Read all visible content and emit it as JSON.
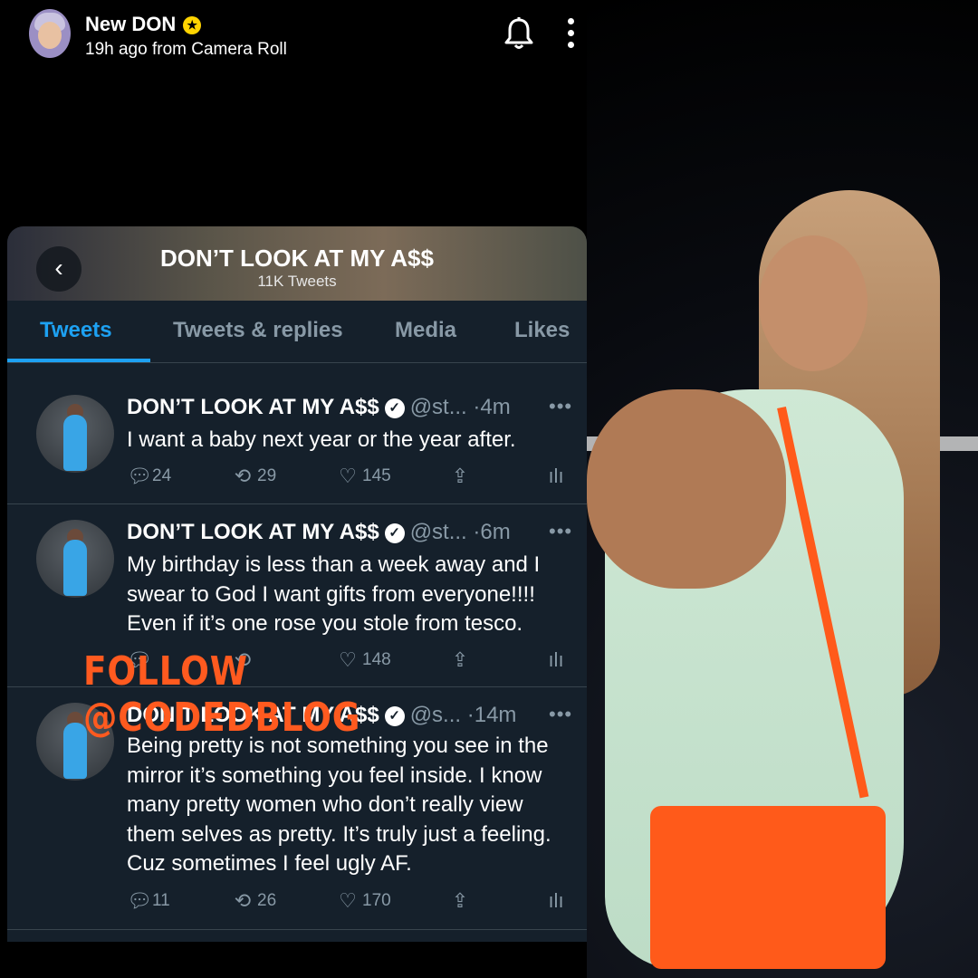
{
  "snap_header": {
    "name": "New DON",
    "subtitle": "19h ago from Camera Roll"
  },
  "twitter": {
    "profile_name": "DON’T LOOK AT MY A$$",
    "tweet_count": "11K Tweets",
    "tabs": [
      "Tweets",
      "Tweets & replies",
      "Media",
      "Likes"
    ],
    "tweets": [
      {
        "name": "DON’T LOOK AT MY A$$",
        "handle": "@st...",
        "time": "·4m",
        "text": "I want a baby next year or the year after.",
        "replies": "24",
        "retweets": "29",
        "likes": "145"
      },
      {
        "name": "DON’T LOOK AT MY A$$",
        "handle": "@st...",
        "time": "·6m",
        "text": "My birthday is less than a week away and I swear to God I want gifts from everyone!!!! Even if it’s one rose you stole from tesco.",
        "replies": "",
        "retweets": "",
        "likes": "148"
      },
      {
        "name": "DON’T LOOK AT MY A$$",
        "handle": "@s...",
        "time": "·14m",
        "text": "Being pretty is not something you see in the mirror it’s something you feel inside. I know many pretty women who don’t really view them selves as pretty. It’s truly just a feeling. Cuz sometimes I feel ugly AF.",
        "replies": "11",
        "retweets": "26",
        "likes": "170"
      }
    ]
  },
  "watermark": "FOLLOW @CODEDBLOG",
  "colors": {
    "twitter_bg": "#15202b",
    "twitter_blue": "#1da1f2",
    "muted": "#8899a6",
    "watermark": "#ff5a1f",
    "snap_star": "#ffd400"
  }
}
